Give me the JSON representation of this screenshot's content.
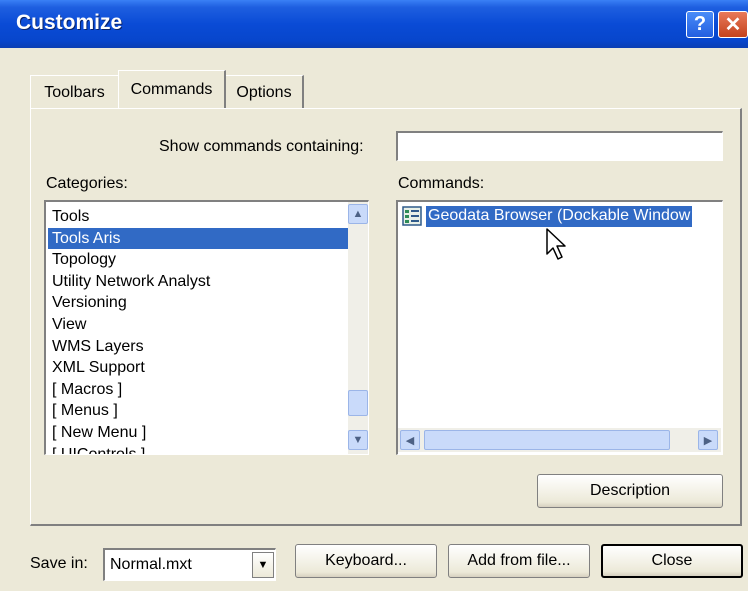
{
  "window": {
    "title": "Customize",
    "help_label": "?",
    "close_label": "✕"
  },
  "tabs": [
    {
      "label": "Toolbars",
      "active": false
    },
    {
      "label": "Commands",
      "active": true
    },
    {
      "label": "Options",
      "active": false
    }
  ],
  "search": {
    "label": "Show commands containing:",
    "value": ""
  },
  "categories": {
    "label": "Categories:",
    "items": [
      "Tools",
      "Tools Aris",
      "Topology",
      "Utility Network Analyst",
      "Versioning",
      "View",
      "WMS Layers",
      "XML Support",
      "[ Macros ]",
      "[ Menus ]",
      "[ New Menu ]",
      "[ UIControls ]"
    ],
    "selected": "Tools Aris"
  },
  "commands": {
    "label": "Commands:",
    "items": [
      "Geodata Browser (Dockable Window"
    ],
    "selected": "Geodata Browser (Dockable Window"
  },
  "buttons": {
    "description": "Description",
    "keyboard": "Keyboard...",
    "add_from_file": "Add from file...",
    "close": "Close"
  },
  "save_in": {
    "label": "Save in:",
    "value": "Normal.mxt"
  },
  "icons": {
    "help": "help-icon",
    "close": "close-icon",
    "scroll_up": "chevron-up-icon",
    "scroll_down": "chevron-down-icon",
    "scroll_left": "chevron-left-icon",
    "scroll_right": "chevron-right-icon",
    "command": "geodata-browser-icon",
    "cursor": "mouse-pointer-icon"
  },
  "colors": {
    "titlebar": "#0a4bd6",
    "selection": "#316ac5",
    "dialog_bg": "#ece9d8"
  }
}
